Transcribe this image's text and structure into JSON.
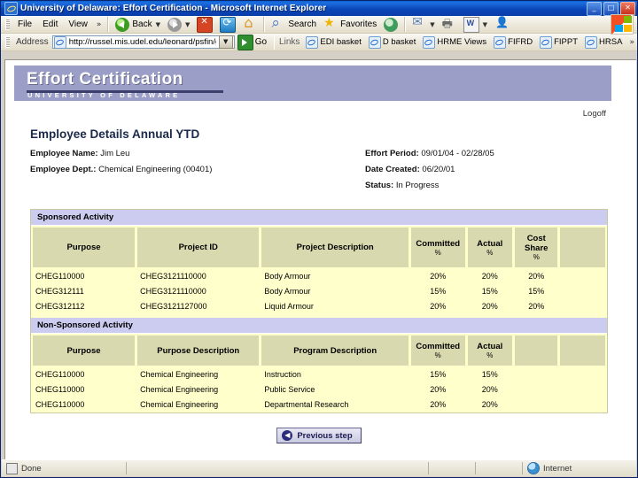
{
  "window": {
    "title": "University of Delaware: Effort Certification - Microsoft Internet Explorer",
    "minimize": "_",
    "maximize": "□",
    "close": "✕"
  },
  "menubar": {
    "items": [
      {
        "label": "File"
      },
      {
        "label": "Edit"
      },
      {
        "label": "View"
      }
    ],
    "overflow": "»"
  },
  "toolbar": {
    "back": "Back",
    "forward": "",
    "stop": "",
    "refresh": "",
    "home": "",
    "search": "Search",
    "favorites": "Favorites",
    "media": "",
    "mail": "",
    "print": "",
    "edit": "",
    "messenger": ""
  },
  "address": {
    "label": "Address",
    "url": "http://russel.mis.udel.edu/leonard/psfin/grants",
    "go": "Go"
  },
  "links": {
    "label": "Links",
    "items": [
      {
        "label": "EDI basket"
      },
      {
        "label": "D basket"
      },
      {
        "label": "HRME Views"
      },
      {
        "label": "FIFRD"
      },
      {
        "label": "FIPPT"
      },
      {
        "label": "HRSA"
      }
    ],
    "overflow": "»"
  },
  "banner": {
    "title": "Effort Certification",
    "subtitle": "UNIVERSITY OF DELAWARE",
    "logoff": "Logoff",
    "color": "#9b9ec6"
  },
  "page": {
    "title": "Employee Details Annual YTD",
    "details_left": [
      {
        "label": "Employee Name:",
        "value": "Jim Leu"
      },
      {
        "label": "Employee Dept.:",
        "value": "Chemical Engineering (00401)"
      }
    ],
    "details_right": [
      {
        "label": "Effort Period:",
        "value": "09/01/04 - 02/28/05"
      },
      {
        "label": "Date Created:",
        "value": "06/20/01"
      },
      {
        "label": "Status:",
        "value": "In Progress"
      }
    ]
  },
  "sponsored": {
    "section_title": "Sponsored Activity",
    "columns": [
      "Purpose",
      "Project ID",
      "Project Description",
      "Committed",
      "Actual",
      "Cost Share",
      ""
    ],
    "column_units": [
      "",
      "",
      "",
      "%",
      "%",
      "%",
      ""
    ],
    "rows": [
      {
        "purpose": "CHEG110000",
        "project_id": "CHEG3121110000",
        "project_description": "Body Armour",
        "committed": "20%",
        "actual": "20%",
        "cost_share": "20%",
        "extra": ""
      },
      {
        "purpose": "CHEG312111",
        "project_id": "CHEG3121110000",
        "project_description": "Body Armour",
        "committed": "15%",
        "actual": "15%",
        "cost_share": "15%",
        "extra": ""
      },
      {
        "purpose": "CHEG312112",
        "project_id": "CHEG3121127000",
        "project_description": "Liquid Armour",
        "committed": "20%",
        "actual": "20%",
        "cost_share": "20%",
        "extra": ""
      }
    ]
  },
  "nonsponsored": {
    "section_title": "Non-Sponsored Activity",
    "columns": [
      "Purpose",
      "Purpose Description",
      "Program Description",
      "Committed",
      "Actual",
      "",
      ""
    ],
    "column_units": [
      "",
      "",
      "",
      "%",
      "%",
      "",
      ""
    ],
    "rows": [
      {
        "purpose": "CHEG110000",
        "purpose_description": "Chemical Engineering",
        "program_description": "Instruction",
        "committed": "15%",
        "actual": "15%",
        "extra1": "",
        "extra2": ""
      },
      {
        "purpose": "CHEG110000",
        "purpose_description": "Chemical Engineering",
        "program_description": "Public Service",
        "committed": "20%",
        "actual": "20%",
        "extra1": "",
        "extra2": ""
      },
      {
        "purpose": "CHEG110000",
        "purpose_description": "Chemical Engineering",
        "program_description": "Departmental Research",
        "committed": "20%",
        "actual": "20%",
        "extra1": "",
        "extra2": ""
      }
    ]
  },
  "footer": {
    "previous_step": "Previous step"
  },
  "statusbar": {
    "status": "Done",
    "zone": "Internet"
  }
}
